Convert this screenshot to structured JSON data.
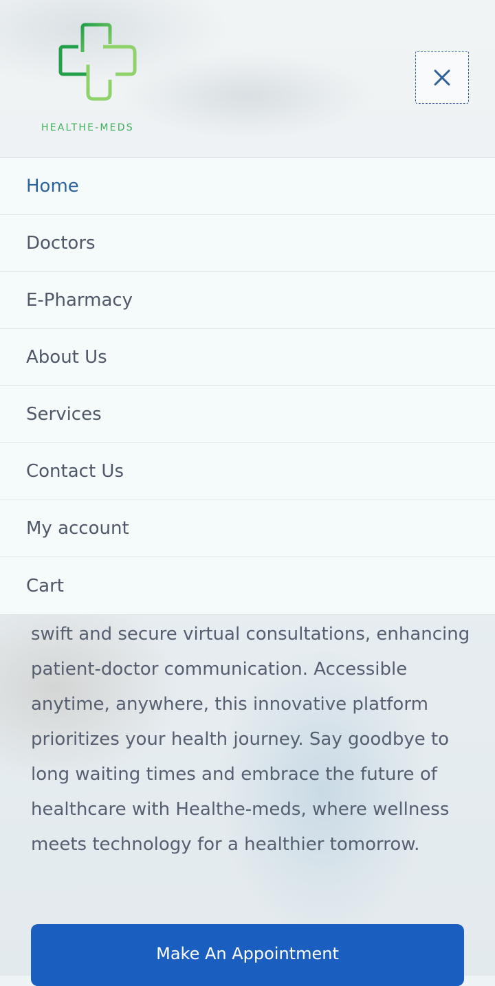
{
  "brand": {
    "name": "HEALTHE-MEDS",
    "logo_icon": "cross-logo-icon",
    "colors": {
      "logo_dark": "#2fa84f",
      "logo_light": "#8fd16a"
    }
  },
  "header": {
    "menu_toggle_icon": "close-icon",
    "accent": "#2e5f96"
  },
  "nav": {
    "items": [
      {
        "label": "Home",
        "active": true
      },
      {
        "label": "Doctors"
      },
      {
        "label": "E-Pharmacy"
      },
      {
        "label": "About Us"
      },
      {
        "label": "Services"
      },
      {
        "label": "Contact Us"
      },
      {
        "label": "My account"
      },
      {
        "label": "Cart"
      }
    ]
  },
  "main": {
    "paragraph": "swift and secure virtual consultations, enhancing patient-doctor communication.  Accessible anytime, anywhere, this innovative platform prioritizes your health journey. Say goodbye to long waiting times and embrace the future of healthcare with Healthe-meds, where wellness meets technology for a healthier tomorrow.",
    "cta_label": "Make An Appointment",
    "cta_color": "#1a5fbf"
  }
}
